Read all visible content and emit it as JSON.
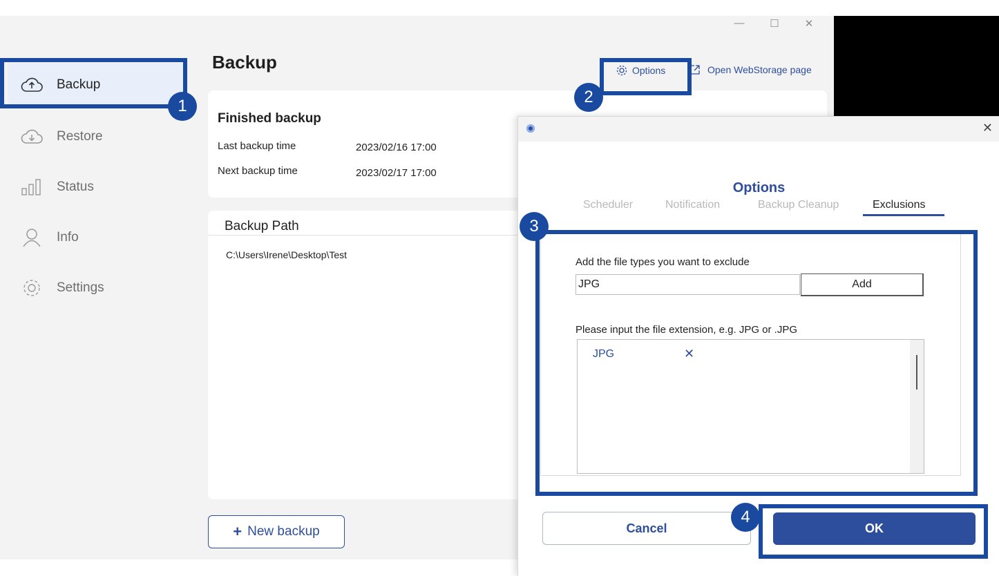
{
  "window": {
    "controls": {
      "minimize": "—",
      "maximize": "☐",
      "close": "✕"
    }
  },
  "sidebar": {
    "items": [
      {
        "label": "Backup",
        "icon": "cloud-upload-icon",
        "active": true
      },
      {
        "label": "Restore",
        "icon": "cloud-download-icon",
        "active": false
      },
      {
        "label": "Status",
        "icon": "bar-chart-icon",
        "active": false
      },
      {
        "label": "Info",
        "icon": "person-icon",
        "active": false
      },
      {
        "label": "Settings",
        "icon": "gear-icon",
        "active": false
      }
    ]
  },
  "main": {
    "title": "Backup",
    "options_link": "Options",
    "webstorage_link": "Open WebStorage page",
    "status": {
      "heading": "Finished backup",
      "last_label": "Last backup time",
      "last_value": "2023/02/16 17:00",
      "next_label": "Next backup time",
      "next_value": "2023/02/17 17:00"
    },
    "path_card": {
      "heading": "Backup Path",
      "path": "C:\\Users\\Irene\\Desktop\\Test"
    },
    "new_backup": {
      "plus": "+",
      "label": "New backup"
    }
  },
  "dialog": {
    "close": "✕",
    "heading": "Options",
    "tabs": [
      "Scheduler",
      "Notification",
      "Backup Cleanup",
      "Exclusions"
    ],
    "active_tab": "Exclusions",
    "add_label": "Add the file types you want to exclude",
    "input_value": "JPG",
    "add_button": "Add",
    "hint": "Please input the file extension, e.g. JPG or .JPG",
    "exclusions": [
      {
        "ext": "JPG",
        "remove": "✕"
      }
    ],
    "cancel": "Cancel",
    "ok": "OK"
  },
  "annotations": {
    "badges": [
      "1",
      "2",
      "3",
      "4"
    ]
  },
  "colors": {
    "accent": "#2d4e9c",
    "annotation": "#1a4aa0",
    "active_nav_bg": "#e8eefa"
  }
}
